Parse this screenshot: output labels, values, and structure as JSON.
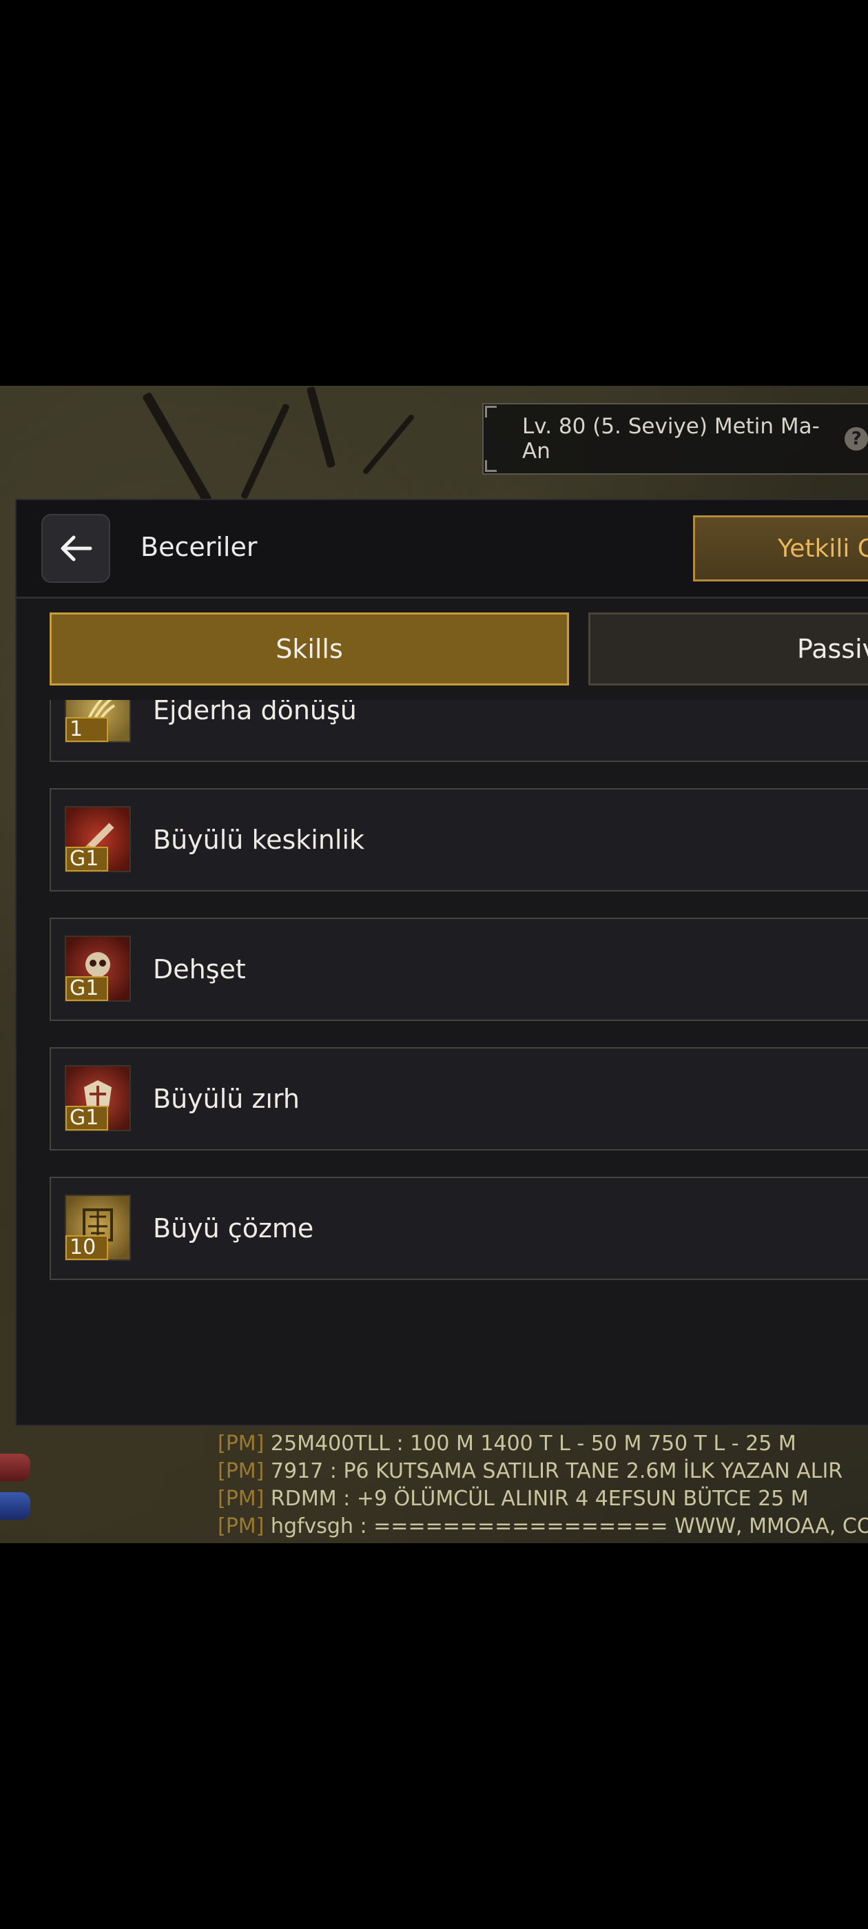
{
  "top_bar": {
    "level_text": "Lv. 80 (5. Seviye) Metin Ma-An",
    "help_glyph": "?"
  },
  "header": {
    "back_icon": "arrow-left-icon",
    "title": "Beceriler",
    "auth_button": "Yetkili C"
  },
  "tabs": {
    "skills": "Skills",
    "passive": "Passiv"
  },
  "skills": [
    {
      "name": "Ejderha dönüşü",
      "badge": "1",
      "icon": "dragon-claw-icon",
      "color": "#a08a3a"
    },
    {
      "name": "Büyülü keskinlik",
      "badge": "G1",
      "icon": "sword-icon",
      "color": "#8a2418"
    },
    {
      "name": "Dehşet",
      "badge": "G1",
      "icon": "skull-icon",
      "color": "#7a2418"
    },
    {
      "name": "Büyülü zırh",
      "badge": "G1",
      "icon": "armor-icon",
      "color": "#8a2a1a"
    },
    {
      "name": "Büyü çözme",
      "badge": "10",
      "icon": "glyph-icon",
      "color": "#9a7e2a"
    }
  ],
  "chat": [
    {
      "tag": "[PM]",
      "text": " 25M400TLL :  100 M  1400  T L -  50 M  750  T L -  25 M"
    },
    {
      "tag": "[PM]",
      "text": " 7917 :  P6 KUTSAMA SATILIR TANE 2.6M İLK YAZAN ALIR"
    },
    {
      "tag": "[PM]",
      "text": " RDMM : +9 ÖLÜMCÜL ALINIR 4 4EFSUN BÜTCE 25 M"
    },
    {
      "tag": "[PM]",
      "text": " hgfvsgh : ================= WWW, MMOAA, COM"
    }
  ]
}
